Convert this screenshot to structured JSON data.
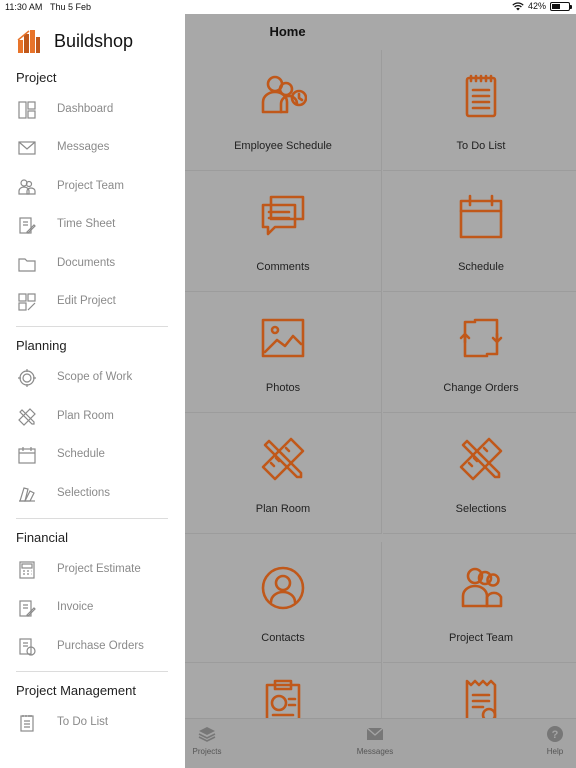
{
  "status": {
    "time": "11:30 AM",
    "date": "Thu 5 Feb",
    "battery": "42%",
    "battery_level": 0.42
  },
  "app": {
    "name": "Buildshop"
  },
  "accent": "#c0581a",
  "sidebar": {
    "sections": [
      {
        "title": "Project",
        "items": [
          {
            "label": "Dashboard",
            "icon": "dashboard-icon"
          },
          {
            "label": "Messages",
            "icon": "envelope-icon"
          },
          {
            "label": "Project Team",
            "icon": "team-icon"
          },
          {
            "label": "Time Sheet",
            "icon": "timesheet-icon"
          },
          {
            "label": "Documents",
            "icon": "folder-icon"
          },
          {
            "label": "Edit Project",
            "icon": "edit-project-icon"
          }
        ]
      },
      {
        "title": "Planning",
        "items": [
          {
            "label": "Scope of Work",
            "icon": "target-icon"
          },
          {
            "label": "Plan Room",
            "icon": "ruler-pencil-icon"
          },
          {
            "label": "Schedule",
            "icon": "calendar-icon"
          },
          {
            "label": "Selections",
            "icon": "swatches-icon"
          }
        ]
      },
      {
        "title": "Financial",
        "items": [
          {
            "label": "Project Estimate",
            "icon": "calculator-icon"
          },
          {
            "label": "Invoice",
            "icon": "invoice-icon"
          },
          {
            "label": "Purchase Orders",
            "icon": "purchase-order-icon"
          }
        ]
      },
      {
        "title": "Project Management",
        "items": [
          {
            "label": "To Do List",
            "icon": "todo-icon"
          }
        ]
      }
    ]
  },
  "home": {
    "title": "Home",
    "tiles": [
      {
        "label": "Employee Schedule",
        "icon": "employee-schedule-icon"
      },
      {
        "label": "To Do List",
        "icon": "notepad-icon"
      },
      {
        "label": "Comments",
        "icon": "comments-icon"
      },
      {
        "label": "Schedule",
        "icon": "calendar-icon"
      },
      {
        "label": "Photos",
        "icon": "photo-icon"
      },
      {
        "label": "Change Orders",
        "icon": "change-orders-icon"
      },
      {
        "label": "Plan Room",
        "icon": "ruler-pencil-icon"
      },
      {
        "label": "Selections",
        "icon": "ruler-pencil-icon"
      },
      {
        "label": "Contacts",
        "icon": "contact-icon"
      },
      {
        "label": "Project Team",
        "icon": "team-icon"
      },
      {
        "label": "",
        "icon": "estimate-clipboard-icon"
      },
      {
        "label": "",
        "icon": "receipt-icon"
      }
    ]
  },
  "tabbar": {
    "tabs": [
      {
        "label": "Projects",
        "icon": "layers-icon"
      },
      {
        "label": "Messages",
        "icon": "envelope-icon"
      },
      {
        "label": "Help",
        "icon": "help-icon"
      }
    ]
  }
}
